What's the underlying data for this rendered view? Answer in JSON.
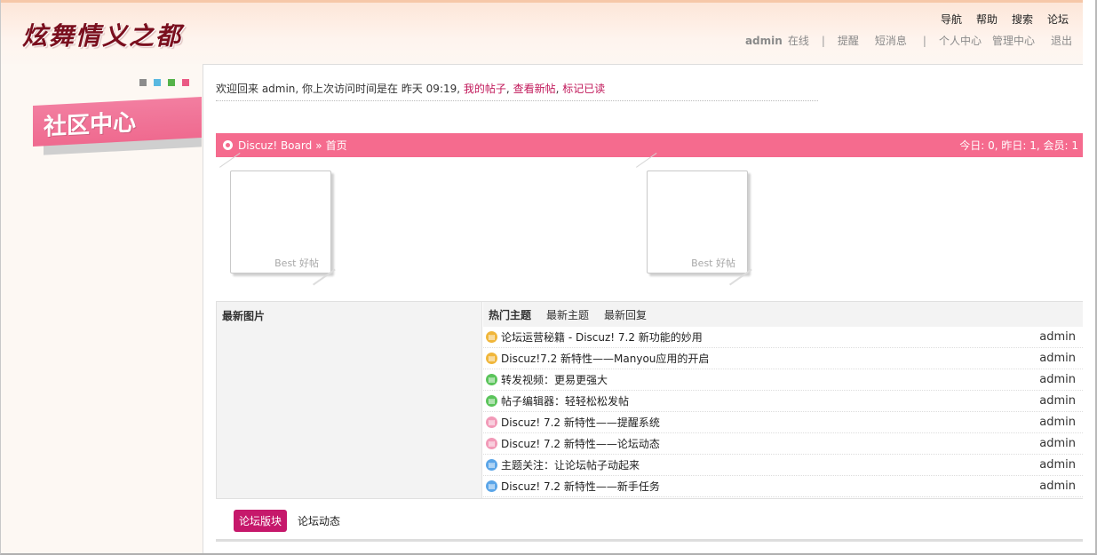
{
  "site": {
    "logo": "炫舞情义之都"
  },
  "topnav": [
    "导航",
    "帮助",
    "搜索",
    "论坛"
  ],
  "usernav": {
    "username": "admin",
    "status": "在线",
    "sep1": "|",
    "reminders": "提醒",
    "messages": "短消息",
    "sep2": "|",
    "profile": "个人中心",
    "admin_center": "管理中心",
    "logout": "退出"
  },
  "sidebar": {
    "dot_colors": [
      "#8c8c8c",
      "#59b8e0",
      "#56b34a",
      "#ea5a84"
    ],
    "banner": "社区中心"
  },
  "welcome": {
    "text": "欢迎回来  admin, 你上次访问时间是在  昨天 09:19,",
    "my_posts": "我的帖子",
    "comma1": ",",
    "new_posts": "查看新帖",
    "comma2": ",",
    "mark_read": "标记已读"
  },
  "breadcrumb": {
    "board": "Discuz! Board",
    "arrow": "»",
    "home": "首页",
    "stats": "今日: 0, 昨日: 1, 会员: 1"
  },
  "best_cards": [
    {
      "label": "Best 好帖"
    },
    {
      "label": "Best 好帖"
    }
  ],
  "pictures": {
    "title": "最新图片"
  },
  "topic_tabs": [
    {
      "label": "热门主题",
      "active": true
    },
    {
      "label": "最新主题",
      "active": false
    },
    {
      "label": "最新回复",
      "active": false
    }
  ],
  "topics": [
    {
      "title": "论坛运营秘籍  - Discuz! 7.2 新功能的妙用",
      "author": "admin",
      "icon_color": "#f0b63a"
    },
    {
      "title": "Discuz!7.2 新特性——Manyou应用的开启",
      "author": "admin",
      "icon_color": "#f0b63a"
    },
    {
      "title": "转发视频：更易更强大",
      "author": "admin",
      "icon_color": "#5bc45b"
    },
    {
      "title": "帖子编辑器：轻轻松松发帖",
      "author": "admin",
      "icon_color": "#5bc45b"
    },
    {
      "title": "Discuz! 7.2 新特性——提醒系统",
      "author": "admin",
      "icon_color": "#f29ab8"
    },
    {
      "title": "Discuz! 7.2 新特性——论坛动态",
      "author": "admin",
      "icon_color": "#f29ab8"
    },
    {
      "title": "主题关注：让论坛帖子动起来",
      "author": "admin",
      "icon_color": "#5aa5e8"
    },
    {
      "title": "Discuz! 7.2 新特性——新手任务",
      "author": "admin",
      "icon_color": "#5aa5e8"
    }
  ],
  "bottom_tabs": {
    "active": "论坛版块",
    "other": "论坛动态"
  },
  "colors": {
    "accent": "#f56b8e",
    "link": "#c1185a",
    "tab_active": "#c6186b",
    "logo": "#7a0f1e"
  }
}
